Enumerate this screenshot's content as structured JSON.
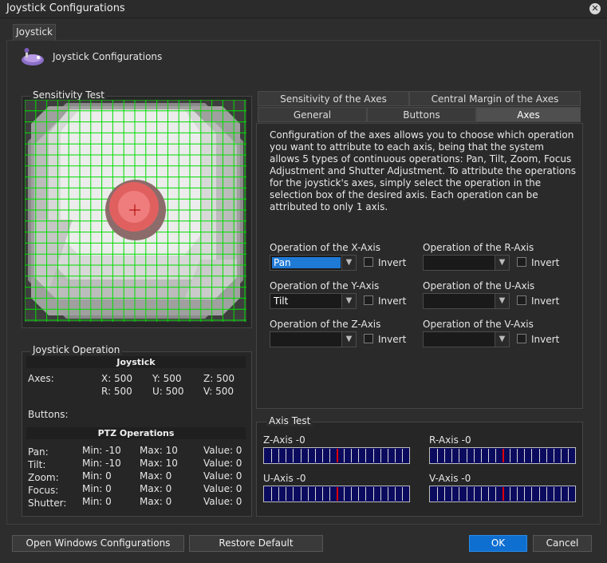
{
  "window": {
    "title": "Joystick Configurations"
  },
  "main_tab": "Joystick",
  "header": {
    "title": "Joystick Configurations",
    "icon": "joystick-icon"
  },
  "sensitivity": {
    "label": "Sensitivity Test"
  },
  "tabs": {
    "row1": [
      "Sensitivity of the Axes",
      "Central Margin of the Axes"
    ],
    "row2": [
      "General",
      "Buttons",
      "Axes"
    ],
    "active": "Axes"
  },
  "description": "Configuration of the axes allows you to choose which operation you want to attribute to each axis, being that the system allows 5 types of continuous operations: Pan, Tilt, Zoom, Focus Adjustment and Shutter Adjustment. To attribute the operations for the joystick's axes, simply select the operation in the selection box of the desired axis. Each operation can be attributed to only 1 axis.",
  "axis_ops": [
    {
      "label": "Operation of the X-Axis",
      "value": "Pan",
      "invert": "Invert"
    },
    {
      "label": "Operation of the R-Axis",
      "value": "",
      "invert": "Invert"
    },
    {
      "label": "Operation of the Y-Axis",
      "value": "Tilt",
      "invert": "Invert"
    },
    {
      "label": "Operation of the U-Axis",
      "value": "",
      "invert": "Invert"
    },
    {
      "label": "Operation of the Z-Axis",
      "value": "",
      "invert": "Invert"
    },
    {
      "label": "Operation of the V-Axis",
      "value": "",
      "invert": "Invert"
    }
  ],
  "axis_test": {
    "label": "Axis Test",
    "meters": [
      {
        "label": "Z-Axis -0",
        "value": 0
      },
      {
        "label": "R-Axis -0",
        "value": 0
      },
      {
        "label": "U-Axis -0",
        "value": 0
      },
      {
        "label": "V-Axis -0",
        "value": 0
      }
    ]
  },
  "operation": {
    "label": "Joystick Operation",
    "joystick_head": "Joystick",
    "axes_label": "Axes:",
    "axes": [
      "X: 500",
      "Y: 500",
      "Z: 500",
      "R: 500",
      "U: 500",
      "V: 500"
    ],
    "buttons_label": "Buttons:",
    "ptz_head": "PTZ Operations",
    "ptz": [
      {
        "name": "Pan:",
        "min": "Min: -10",
        "max": "Max: 10",
        "value": "Value: 0"
      },
      {
        "name": "Tilt:",
        "min": "Min: -10",
        "max": "Max: 10",
        "value": "Value: 0"
      },
      {
        "name": "Zoom:",
        "min": "Min: 0",
        "max": "Max: 0",
        "value": "Value: 0"
      },
      {
        "name": "Focus:",
        "min": "Min: 0",
        "max": "Max: 0",
        "value": "Value: 0"
      },
      {
        "name": "Shutter:",
        "min": "Min: 0",
        "max": "Max: 0",
        "value": "Value: 0"
      }
    ]
  },
  "buttons": {
    "open_windows": "Open Windows Configurations",
    "restore": "Restore Default",
    "ok": "OK",
    "cancel": "Cancel"
  },
  "colors": {
    "accent": "#0f6fd0",
    "grid": "#00dd00",
    "marker": "#ff4040"
  }
}
